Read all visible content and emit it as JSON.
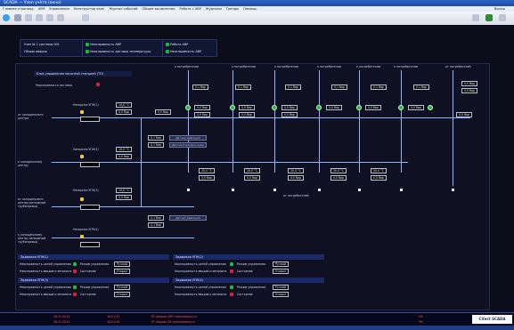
{
  "window": {
    "title": "SCADA — Узел учёта (окно)"
  },
  "menu": [
    "Главная страница",
    "АРМ",
    "Управление",
    "Конструктор окон",
    "Журнал событий",
    "Общие вычисления",
    "Работа с АВР",
    "Журналы",
    "Тренды",
    "Помощь"
  ],
  "menu_right": "Выход",
  "header": {
    "panel_a": [
      "Узел № 1 системы 001",
      "Общая авария"
    ],
    "panel_b": [
      "Неисправность АВР",
      "Неисправность датчика температуры"
    ],
    "panel_c": [
      "Работа АВР",
      "Неисправность АВР"
    ]
  },
  "main": {
    "title": "Блок управления насосной станцией (ТП)",
    "fault": "Неисправность системы",
    "consumers": [
      "к потребителям",
      "к потребителям",
      "к потребителям",
      "к потребителям",
      "к потребителям",
      "к потребителям",
      "от потребителей"
    ],
    "top_values": [
      "0,1 бар",
      "0,1 бар",
      "0,1 бар",
      "0,1 бар",
      "0,1 бар",
      "0,1 бар",
      "0,1 бар",
      "0,1 бар"
    ],
    "mid_values": [
      "0,0 бар",
      "0,0 бар",
      "0,0 бар",
      "0,0 бар",
      "0,0 бар",
      "0,0 бар",
      "0,0 бар",
      "0,0 бар",
      "0,0 бар",
      "0,0 бар"
    ],
    "valve_labels": [
      "ВЗ",
      "ВЗ",
      "ВЗ",
      "ВЗ",
      "ВЗ",
      "ВЗ",
      "ВЗ"
    ],
    "rows": [
      {
        "label": "от холодильного центра",
        "pump_title": "Напорная УПН(1)",
        "v1": "10,0 °C",
        "v2": "0,0 бар",
        "v3": "0,0 бар"
      },
      {
        "label": "к холодильному центру",
        "pump_title": "Напорная УПН(2)",
        "v1": "10,0 °C",
        "v2": "0,0 бар",
        "v3": "0,0 бар"
      },
      {
        "label": "от холодильного центра резервный трубопровод",
        "pump_title": "Напорная УПН(3)",
        "v1": "10,0 °C",
        "v2": "0,0 бар",
        "v3": "0,0 бар"
      },
      {
        "label": "к холодильному центру резервный трубопровод",
        "pump_title": "Напорная УПН(4)",
        "v1": "",
        "v2": "",
        "v3": ""
      }
    ],
    "temps": [
      "20,0 °C",
      "20,0 °C",
      "20,0 °C",
      "20,0 °C",
      "20,0 °C"
    ],
    "temps_b": [
      "0,0 бар",
      "0,0 бар",
      "0,0 бар",
      "0,0 бар",
      "0,0 бар"
    ],
    "std_buttons": [
      "Датчик давления",
      "Датчик Р входа и хода",
      "Датчик давления"
    ],
    "std_values": [
      "0,1 бар",
      "0,1 бар",
      "0,1 бар",
      "0,1 бар"
    ],
    "right_values": [
      "0,0 бар",
      "5,0 бар"
    ],
    "from_consumers": "от потребителей"
  },
  "bottom": {
    "sections": [
      {
        "head": "Задвижка УПН(1)",
        "rows": [
          [
            "Неисправность цепей управления",
            "Режим управления",
            "Ручной"
          ],
          [
            "Неисправность вводов и автомата",
            "Состояние",
            "Открыт"
          ]
        ]
      },
      {
        "head": "Задвижка УПН(2)",
        "rows": [
          [
            "Неисправность цепей управления",
            "Режим управления",
            "Ручной"
          ],
          [
            "Неисправность вводов и автомата",
            "Состояние",
            "Открыт"
          ]
        ]
      },
      {
        "head": "Задвижка УПН(3)",
        "rows": [
          [
            "Неисправность цепей управления",
            "Режим управления",
            "Ручной"
          ],
          [
            "Неисправность вводов и автомата",
            "Состояние",
            "Открыт"
          ]
        ]
      },
      {
        "head": "Задвижка УПН(4)",
        "rows": [
          [
            "Неисправность цепей управления",
            "Режим управления",
            "Ручной"
          ],
          [
            "Неисправность вводов и автомата",
            "Состояние",
            "Открыт"
          ]
        ]
      }
    ]
  },
  "status": {
    "rows": [
      [
        "26.01.2014",
        "18:01:41",
        "PC  Авария  АВР  неисправность",
        "ОК"
      ],
      [
        "26.01.2014",
        "18:01:46",
        "PC  Авария  AS  неисправность",
        "ОК"
      ]
    ],
    "brand": "Citect SCADA"
  },
  "colors": {
    "ok": "#1dbb3a",
    "fault": "#d8243a",
    "pipe": "#8fb4ff",
    "bg": "#0f1022"
  }
}
